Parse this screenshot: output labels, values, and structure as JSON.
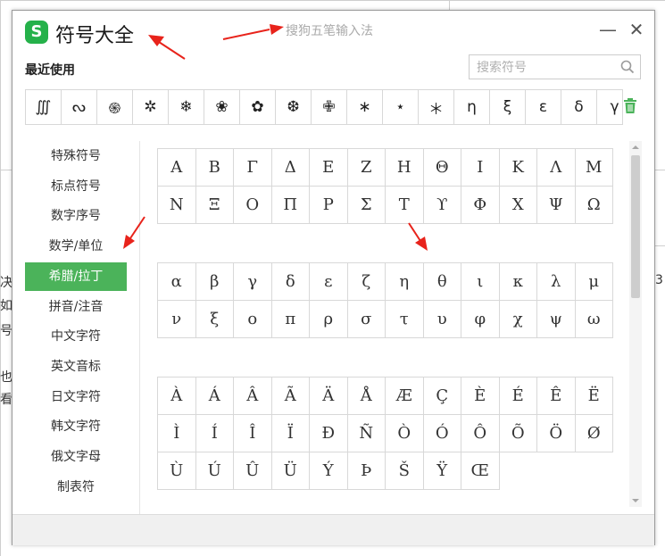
{
  "background": {
    "fragments": [
      "决",
      "如",
      "号",
      "也",
      "看",
      "3"
    ]
  },
  "window": {
    "app_title": "符号大全",
    "ime_title": "搜狗五笔输入法",
    "logo_letter": "S",
    "minimize_symbol": "—",
    "close_symbol": "✕",
    "recent_label": "最近使用",
    "search_placeholder": "搜索符号"
  },
  "recent_symbols": [
    "∭",
    "ᔓ",
    "֍",
    "✲",
    "❄",
    "❀",
    "✿",
    "❆",
    "✙",
    "∗",
    "⋆",
    "＊",
    "η",
    "ξ",
    "ε",
    "δ",
    "γ"
  ],
  "sidebar": {
    "items": [
      "特殊符号",
      "标点符号",
      "数字序号",
      "数学/单位",
      "希腊/拉丁",
      "拼音/注音",
      "中文字符",
      "英文音标",
      "日文字符",
      "韩文字符",
      "俄文字母",
      "制表符"
    ],
    "active_index": 4
  },
  "greek_upper": [
    "Α",
    "Β",
    "Γ",
    "Δ",
    "Ε",
    "Ζ",
    "Η",
    "Θ",
    "Ι",
    "Κ",
    "Λ",
    "Μ",
    "Ν",
    "Ξ",
    "Ο",
    "Π",
    "Ρ",
    "Σ",
    "Τ",
    "ϒ",
    "Φ",
    "Χ",
    "Ψ",
    "Ω"
  ],
  "greek_lower": [
    "α",
    "β",
    "γ",
    "δ",
    "ε",
    "ζ",
    "η",
    "θ",
    "ι",
    "κ",
    "λ",
    "μ",
    "ν",
    "ξ",
    "ο",
    "π",
    "ρ",
    "σ",
    "τ",
    "υ",
    "φ",
    "χ",
    "ψ",
    "ω"
  ],
  "latin": [
    "À",
    "Á",
    "Â",
    "Ã",
    "Ä",
    "Å",
    "Æ",
    "Ç",
    "È",
    "É",
    "Ê",
    "Ë",
    "Ì",
    "Í",
    "Î",
    "Ï",
    "Ð",
    "Ñ",
    "Ò",
    "Ó",
    "Ô",
    "Õ",
    "Ö",
    "Ø",
    "Ù",
    "Ú",
    "Û",
    "Ü",
    "Ý",
    "Þ",
    "Š",
    "Ÿ",
    "Œ"
  ],
  "colors": {
    "accent": "#4bb35a",
    "logo": "#25b14a",
    "annotation_arrow": "#e8231b",
    "trash": "#4bb35a"
  }
}
